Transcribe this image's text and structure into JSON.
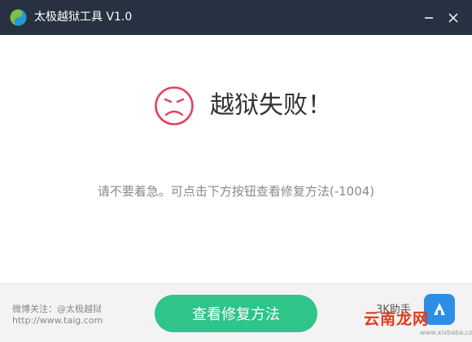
{
  "window": {
    "title": "太极越狱工具 V1.0"
  },
  "result": {
    "title": "越狱失败！",
    "hint": "请不要着急。可点击下方按钮查看修复方法(-1004)"
  },
  "footer": {
    "weibo": "微博关注：@太极越狱",
    "url": "http://www.taig.com",
    "repair_button_label": "查看修复方法",
    "assistant_label": "3K助手"
  },
  "watermark": {
    "brand": "云南龙网",
    "url": "www.xixbaba.com"
  },
  "colors": {
    "titlebar": "#283141",
    "accent_green": "#2ec48a",
    "sad_face": "#e0435c",
    "watermark_red": "#e03a1e"
  },
  "icons": {
    "logo": "taiji-logo-icon",
    "minimize": "minimize-icon",
    "close": "close-icon",
    "status": "sad-face-icon",
    "assistant": "assistant-app-icon"
  }
}
